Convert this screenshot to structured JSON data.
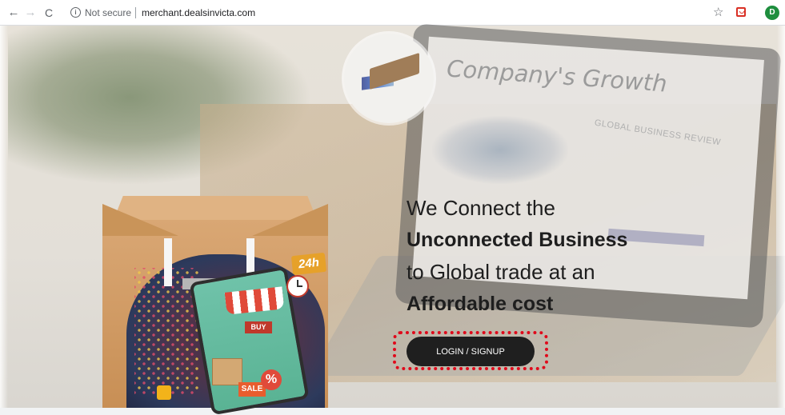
{
  "browser": {
    "back_icon": "back-arrow-icon",
    "forward_icon": "forward-arrow-icon",
    "reload_icon": "reload-icon",
    "info_icon": "info-icon",
    "security_label": "Not secure",
    "url": "merchant.dealsinvicta.com",
    "star_icon": "star-icon",
    "extension_icon": "extension-icon",
    "avatar_letter": "D",
    "avatar_color": "#1e8e3e"
  },
  "background": {
    "laptop_heading": "Company's Growth",
    "laptop_subheading": "GLOBAL BUSINESS REVIEW"
  },
  "illustration": {
    "badge_24h": "24h",
    "buy_sign": "BUY",
    "sale_tag": "SALE",
    "percent_sign": "%"
  },
  "hero": {
    "line1": "We Connect the",
    "line2": "Unconnected Business",
    "line3": "to Global trade at an",
    "line4": "Affordable cost"
  },
  "cta": {
    "label": "LOGIN / SIGNUP",
    "highlight_color": "#e0091b",
    "button_color": "#1f1f1f"
  }
}
